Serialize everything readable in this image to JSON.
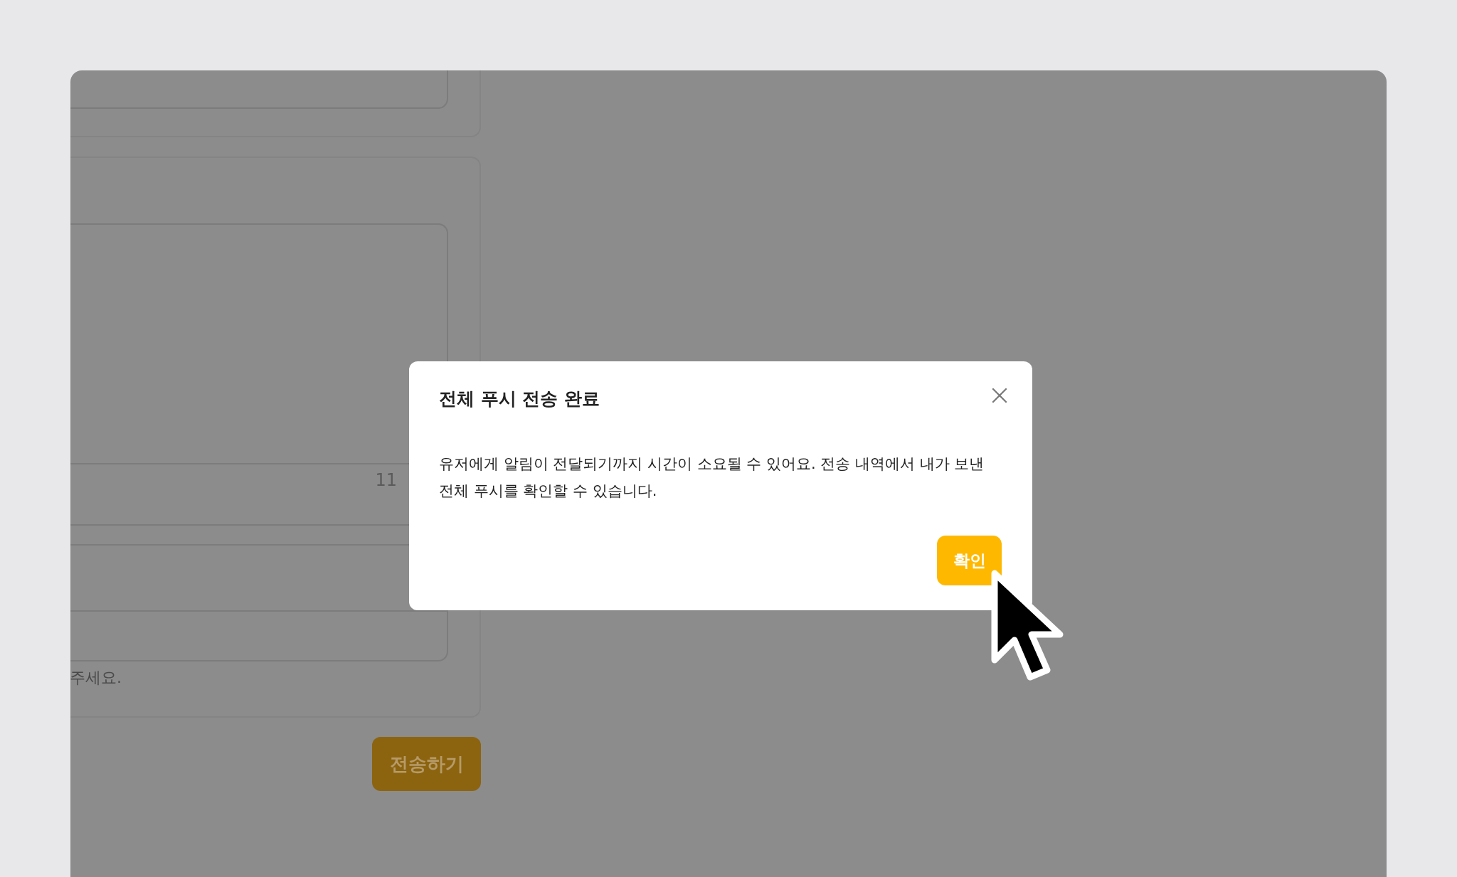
{
  "background_form": {
    "character_count": "11",
    "hint": "주세요.",
    "send_button": "전송하기"
  },
  "dialog": {
    "title": "전체 푸시 전송 완료",
    "message": "유저에게 알림이 전달되기까지 시간이 소요될 수 있어요. 전송 내역에서 내가 보낸 전체 푸시를 확인할 수 있습니다.",
    "confirm_button": "확인"
  }
}
